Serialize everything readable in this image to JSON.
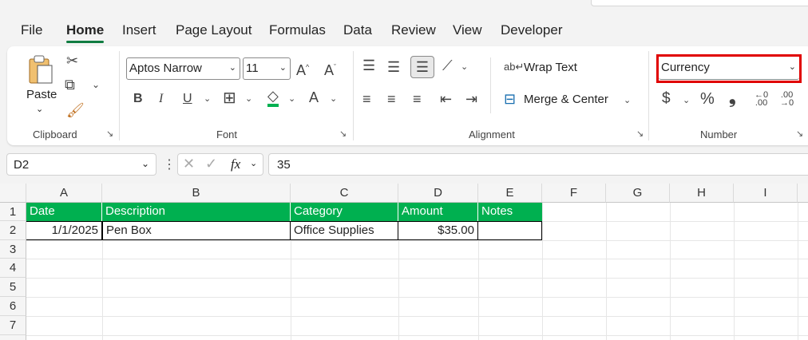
{
  "tabs": [
    "File",
    "Home",
    "Insert",
    "Page Layout",
    "Formulas",
    "Data",
    "Review",
    "View",
    "Developer"
  ],
  "active_tab": "Home",
  "clipboard": {
    "paste_label": "Paste",
    "group_label": "Clipboard"
  },
  "font": {
    "family": "Aptos Narrow",
    "size": "11",
    "group_label": "Font",
    "bold": "B",
    "italic": "I",
    "underline": "U"
  },
  "alignment": {
    "wrap_text": "Wrap Text",
    "merge_center": "Merge & Center",
    "group_label": "Alignment"
  },
  "number": {
    "format": "Currency",
    "group_label": "Number",
    "currency_symbol": "$",
    "percent_symbol": "%",
    "comma_symbol": "❟"
  },
  "formula_bar": {
    "name_box": "D2",
    "fx_label": "fx",
    "value": "35"
  },
  "colors": {
    "accent": "#107c41",
    "header_fill": "#00b050",
    "highlight": "#e00000"
  },
  "sheet": {
    "columns": [
      "A",
      "B",
      "C",
      "D",
      "E",
      "F",
      "G",
      "H",
      "I"
    ],
    "rows": [
      "1",
      "2",
      "3",
      "4",
      "5",
      "6",
      "7"
    ],
    "headers": [
      "Date",
      "Description",
      "Category",
      "Amount",
      "Notes"
    ],
    "data": [
      [
        "1/1/2025",
        "Pen Box",
        "Office Supplies",
        "$35.00",
        ""
      ]
    ]
  }
}
